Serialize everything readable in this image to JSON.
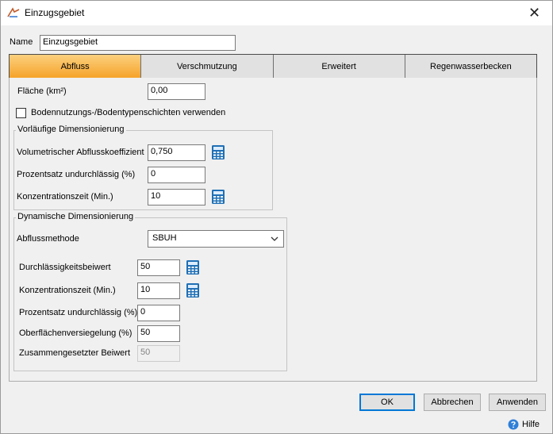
{
  "window": {
    "title": "Einzugsgebiet",
    "close_glyph": "✕"
  },
  "name": {
    "label": "Name",
    "value": "Einzugsgebiet"
  },
  "tabs": [
    {
      "label": "Abfluss",
      "active": true
    },
    {
      "label": "Verschmutzung",
      "active": false
    },
    {
      "label": "Erweitert",
      "active": false
    },
    {
      "label": "Regenwasserbecken",
      "active": false
    }
  ],
  "area": {
    "label": "Fläche (km²)",
    "value": "0,00"
  },
  "soil_layers": {
    "label": "Bodennutzungs-/Bodentypenschichten verwenden",
    "checked": false
  },
  "preliminary": {
    "title": "Vorläufige Dimensionierung",
    "runoff_coef_label": "Volumetrischer Abflusskoeffizient",
    "runoff_coef_value": "0,750",
    "impervious_label": "Prozentsatz undurchlässig (%)",
    "impervious_value": "0",
    "tc_label": "Konzentrationszeit (Min.)",
    "tc_value": "10"
  },
  "dynamic": {
    "title": "Dynamische Dimensionierung",
    "method_label": "Abflussmethode",
    "method_value": "SBUH",
    "permeability_label": "Durchlässigkeitsbeiwert",
    "permeability_value": "50",
    "tc_label": "Konzentrationszeit (Min.)",
    "tc_value": "10",
    "impervious_label": "Prozentsatz undurchlässig (%)",
    "impervious_value": "0",
    "sealing_label": "Oberflächenversiegelung (%)",
    "sealing_value": "50",
    "composite_label": "Zusammengesetzter Beiwert",
    "composite_value": "50"
  },
  "buttons": {
    "ok": "OK",
    "cancel": "Abbrechen",
    "apply": "Anwenden",
    "help": "Hilfe"
  },
  "colors": {
    "active_tab_top": "#fcd07e",
    "active_tab_bottom": "#f6a32a",
    "calc_blue": "#1f6fb5",
    "help_blue": "#2f7fd8"
  },
  "icons": {
    "calculator": "calculator-icon",
    "help": "help-icon",
    "app": "app-icon",
    "close": "close-icon",
    "dropdown": "chevron-down-icon"
  }
}
